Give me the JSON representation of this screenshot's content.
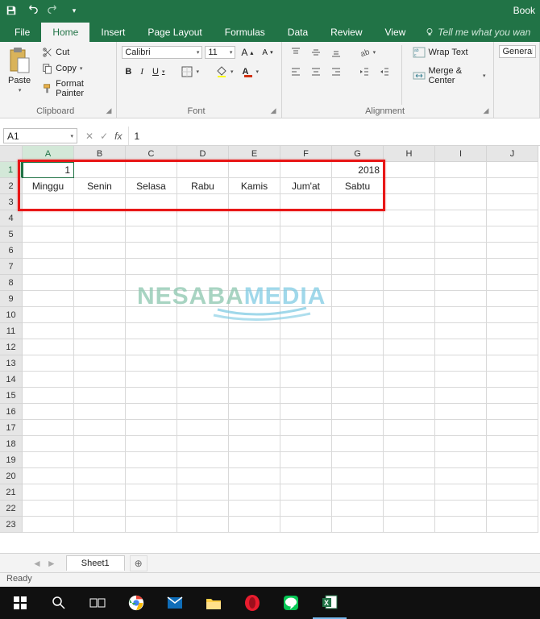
{
  "titlebar": {
    "book": "Book"
  },
  "tabs": {
    "file": "File",
    "home": "Home",
    "insert": "Insert",
    "page_layout": "Page Layout",
    "formulas": "Formulas",
    "data": "Data",
    "review": "Review",
    "view": "View",
    "tellme": "Tell me what you wan"
  },
  "clipboard": {
    "paste": "Paste",
    "cut": "Cut",
    "copy": "Copy",
    "format_painter": "Format Painter",
    "label": "Clipboard"
  },
  "font": {
    "name": "Calibri",
    "size": "11",
    "label": "Font"
  },
  "alignment": {
    "wrap": "Wrap Text",
    "merge": "Merge & Center",
    "label": "Alignment"
  },
  "number": {
    "format": "General"
  },
  "namebox": "A1",
  "formula": "1",
  "columns": [
    "A",
    "B",
    "C",
    "D",
    "E",
    "F",
    "G",
    "H",
    "I",
    "J"
  ],
  "row_count": 23,
  "cells": {
    "A1": "1",
    "G1": "2018",
    "A2": "Minggu",
    "B2": "Senin",
    "C2": "Selasa",
    "D2": "Rabu",
    "E2": "Kamis",
    "F2": "Jum'at",
    "G2": "Sabtu"
  },
  "sheet": {
    "name": "Sheet1"
  },
  "status": "Ready",
  "watermark": {
    "a": "NESABA",
    "b": "MEDIA"
  }
}
